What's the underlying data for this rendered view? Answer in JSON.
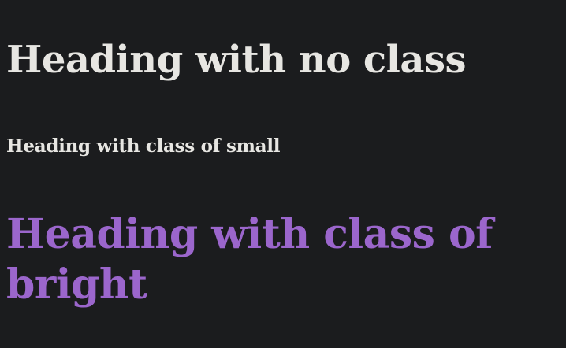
{
  "headings": {
    "no_class": "Heading with no class",
    "small": "Heading with class of small",
    "bright": "Heading with class of bright"
  },
  "colors": {
    "background": "#1b1c1e",
    "text": "#e7e6e2",
    "bright": "#9b66cc"
  }
}
